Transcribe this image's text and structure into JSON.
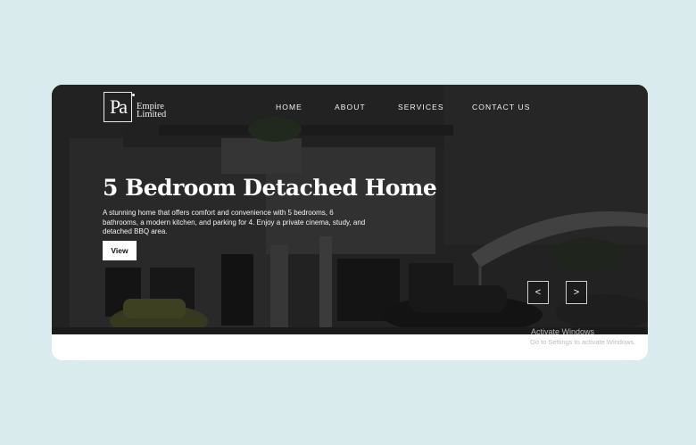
{
  "brand": {
    "mark": "Pa",
    "name_line1": "Empire",
    "name_line2": "Limited"
  },
  "nav": {
    "items": [
      {
        "label": "HOME"
      },
      {
        "label": "ABOUT"
      },
      {
        "label": "SERVICES"
      },
      {
        "label": "CONTACT US"
      }
    ]
  },
  "hero": {
    "title": "5 Bedroom Detached Home",
    "description": "A stunning home that offers comfort and convenience with 5 bedrooms, 6 bathrooms, a modern kitchen, and parking for 4. Enjoy a private cinema, study, and detached BBQ area.",
    "cta_label": "View",
    "prev_label": "<",
    "next_label": ">"
  },
  "watermark": {
    "line1": "Activate Windows",
    "line2": "Go to Settings to activate Windows."
  },
  "colors": {
    "page_background": "#daebed",
    "hero_overlay": "#2a2a2a",
    "text": "#ffffff"
  }
}
